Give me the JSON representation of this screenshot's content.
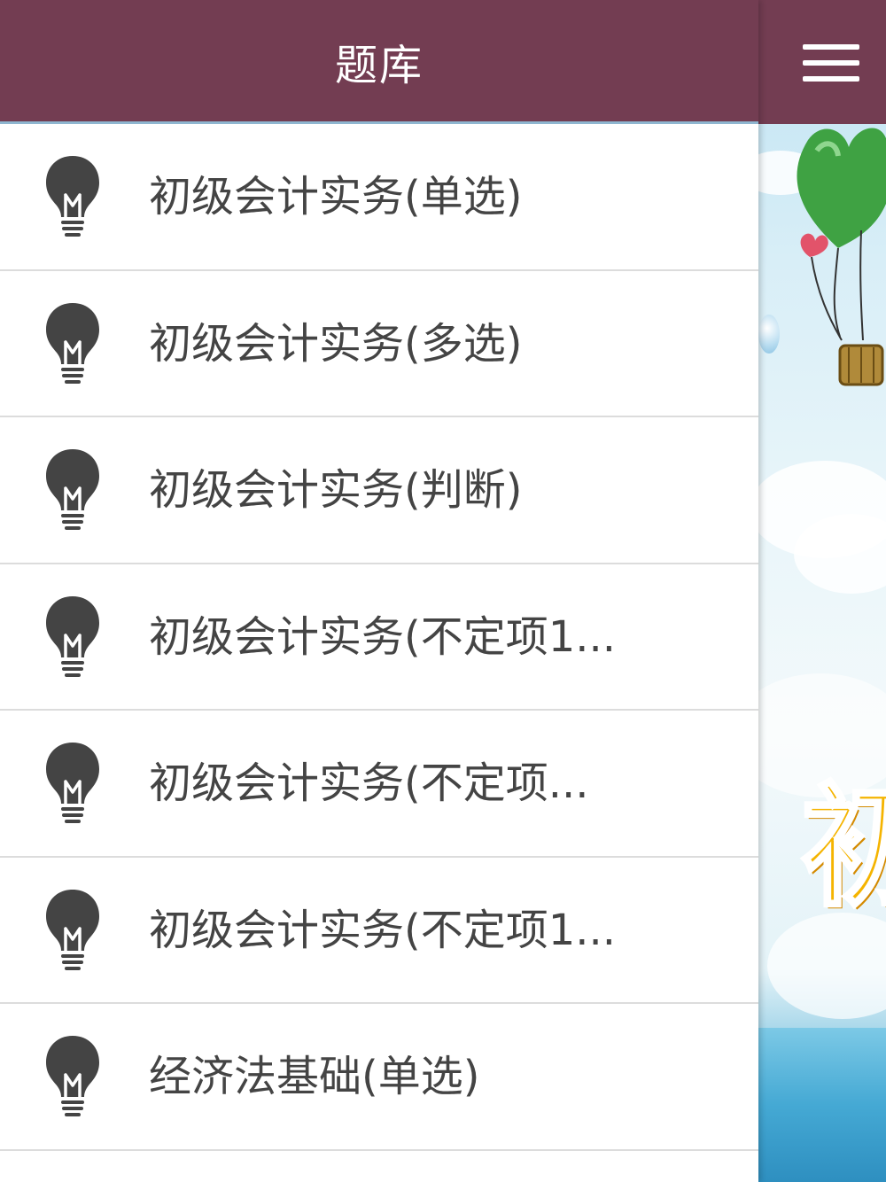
{
  "header": {
    "title": "题库"
  },
  "menu_button": {
    "icon": "menu-icon"
  },
  "list": {
    "icon": "lightbulb-icon",
    "items": [
      {
        "label": "初级会计实务(单选)"
      },
      {
        "label": "初级会计实务(多选)"
      },
      {
        "label": "初级会计实务(判断)"
      },
      {
        "label": "初级会计实务(不定项1..."
      },
      {
        "label": "初级会计实务(不定项..."
      },
      {
        "label": "初级会计实务(不定项1..."
      },
      {
        "label": "经济法基础(单选)"
      }
    ]
  },
  "background": {
    "logo_char": "初"
  },
  "colors": {
    "header_bg": "#733d52",
    "icon_color": "#444444",
    "text_color": "#444444",
    "logo_color": "#f5b400"
  }
}
